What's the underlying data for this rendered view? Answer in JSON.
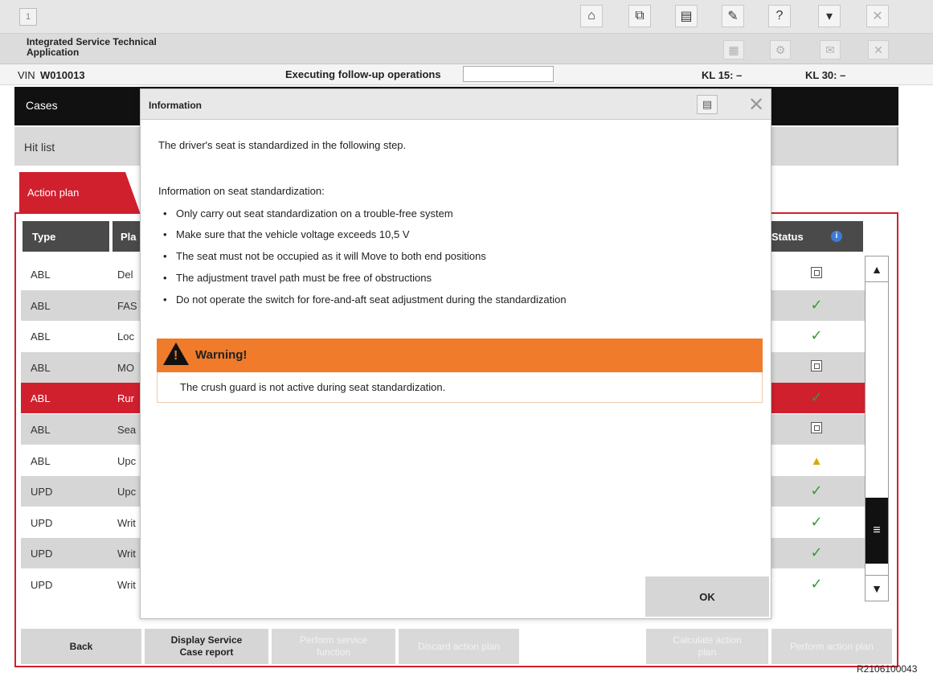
{
  "toolbar": {
    "window_number": "1",
    "icons": [
      "home-icon",
      "connection-icon",
      "print-icon",
      "wrench-icon",
      "help-icon",
      "minimize-icon",
      "close-icon"
    ]
  },
  "title_bar": {
    "app_title": "Integrated Service Technical Application",
    "icons": [
      "measurement-icon",
      "settings-icon",
      "mail-icon",
      "close-icon"
    ]
  },
  "status": {
    "vin_label": "VIN",
    "vin_value": "W010013",
    "executing_label": "Executing follow-up operations",
    "kl15": "KL 15:  –",
    "kl30": "KL 30:  –"
  },
  "nav": {
    "cases": "Cases",
    "hit_list": "Hit list",
    "action_plan_tab": "Action plan"
  },
  "table": {
    "col_type": "Type",
    "col_plan": "Pla",
    "col_status": "Status",
    "rows": [
      {
        "type": "ABL",
        "plan": "Del",
        "status": "box"
      },
      {
        "type": "ABL",
        "plan": "FAS",
        "status": "check"
      },
      {
        "type": "ABL",
        "plan": "Loc",
        "status": "check"
      },
      {
        "type": "ABL",
        "plan": "MO",
        "status": "box"
      },
      {
        "type": "ABL",
        "plan": "Rur",
        "status": "check"
      },
      {
        "type": "ABL",
        "plan": "Sea",
        "status": "box"
      },
      {
        "type": "ABL",
        "plan": "Upc",
        "status": "warning"
      },
      {
        "type": "UPD",
        "plan": "Upc",
        "status": "check"
      },
      {
        "type": "UPD",
        "plan": "Writ",
        "status": "check"
      },
      {
        "type": "UPD",
        "plan": "Writ",
        "status": "check"
      },
      {
        "type": "UPD",
        "plan": "Writ",
        "status": "check"
      }
    ]
  },
  "buttons": {
    "back": "Back",
    "display_report_1": "Display Service",
    "display_report_2": "Case report",
    "perform_service_1": "Perform service",
    "perform_service_2": "function",
    "discard": "Discard action plan",
    "calculate_1": "Calculate action",
    "calculate_2": "plan",
    "perform_plan": "Perform action plan"
  },
  "dialog": {
    "title": "Information",
    "intro": "The driver's seat is standardized in the following step.",
    "info_heading": "Information on seat standardization:",
    "bullets": [
      "Only carry out seat standardization on a trouble-free system",
      "Make sure that the vehicle voltage exceeds 10,5 V",
      "The seat must not be occupied as it will Move to both end positions",
      "The adjustment travel path must be free of obstructions",
      "Do not operate the switch for fore-and-aft seat adjustment during the standardization"
    ],
    "warning_title": "Warning!",
    "warning_text": "The crush guard is not active during seat standardization.",
    "ok": "OK"
  },
  "reference_code": "R2106100043",
  "colors": {
    "accent_red": "#d0202e",
    "warning_orange": "#ef7b2b",
    "check_green": "#2e9e2e"
  }
}
